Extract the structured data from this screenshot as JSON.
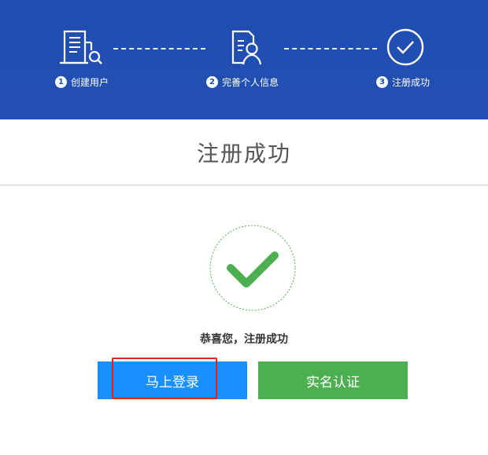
{
  "steps": [
    {
      "number": "1",
      "label": "创建用户",
      "icon": "building-search-icon"
    },
    {
      "number": "2",
      "label": "完善个人信息",
      "icon": "document-user-icon"
    },
    {
      "number": "3",
      "label": "注册成功",
      "icon": "check-circle-icon"
    }
  ],
  "page_title": "注册成功",
  "success_message": "恭喜您，注册成功",
  "buttons": {
    "login_label": "马上登录",
    "verify_label": "实名认证"
  },
  "colors": {
    "header_bg": "#1f4fb0",
    "login_button": "#1890ff",
    "verify_button": "#4caf50",
    "check_green": "#4caf50",
    "highlight": "#e02020"
  }
}
